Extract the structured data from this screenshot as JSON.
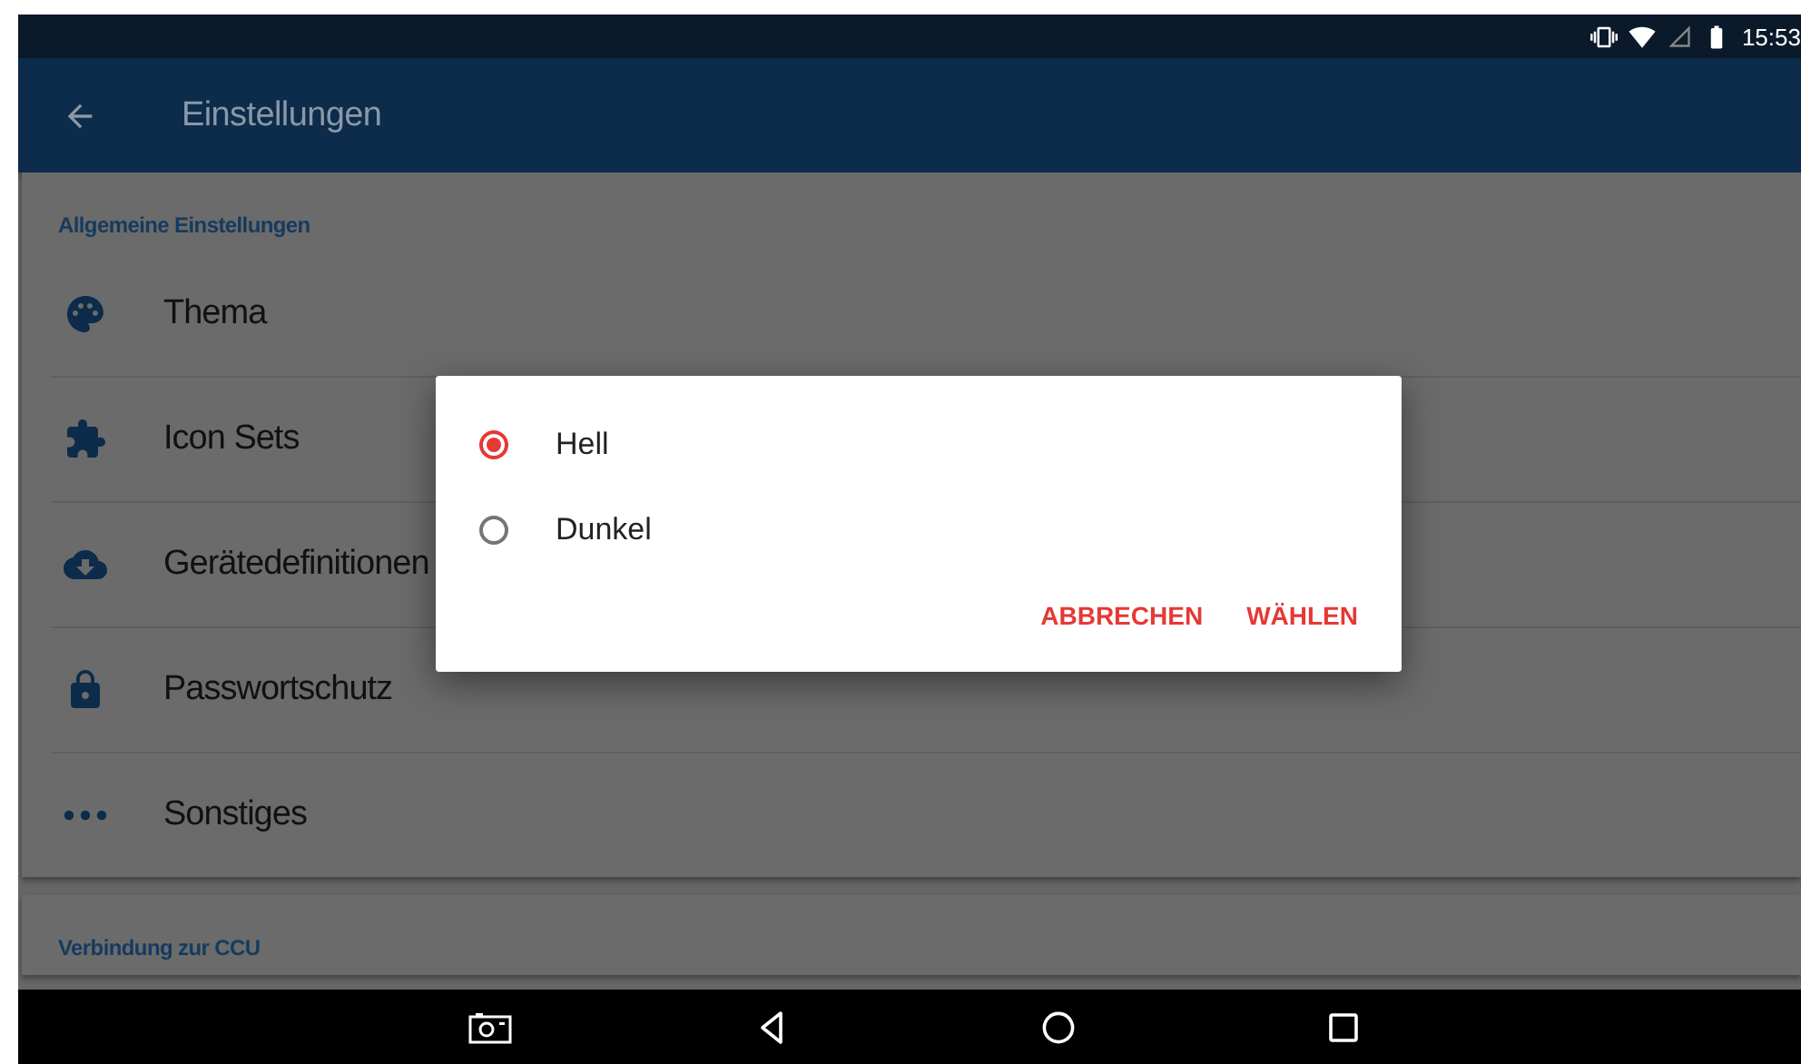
{
  "status_bar": {
    "time": "15:53"
  },
  "app_bar": {
    "title": "Einstellungen"
  },
  "sections": [
    {
      "header": "Allgemeine Einstellungen",
      "items": [
        {
          "label": "Thema"
        },
        {
          "label": "Icon Sets"
        },
        {
          "label": "Gerätedefinitionen"
        },
        {
          "label": "Passwortschutz"
        },
        {
          "label": "Sonstiges"
        }
      ]
    },
    {
      "header": "Verbindung zur CCU"
    }
  ],
  "dialog": {
    "options": [
      {
        "label": "Hell",
        "selected": true
      },
      {
        "label": "Dunkel",
        "selected": false
      }
    ],
    "buttons": [
      "ABBRECHEN",
      "WÄHLEN"
    ]
  }
}
